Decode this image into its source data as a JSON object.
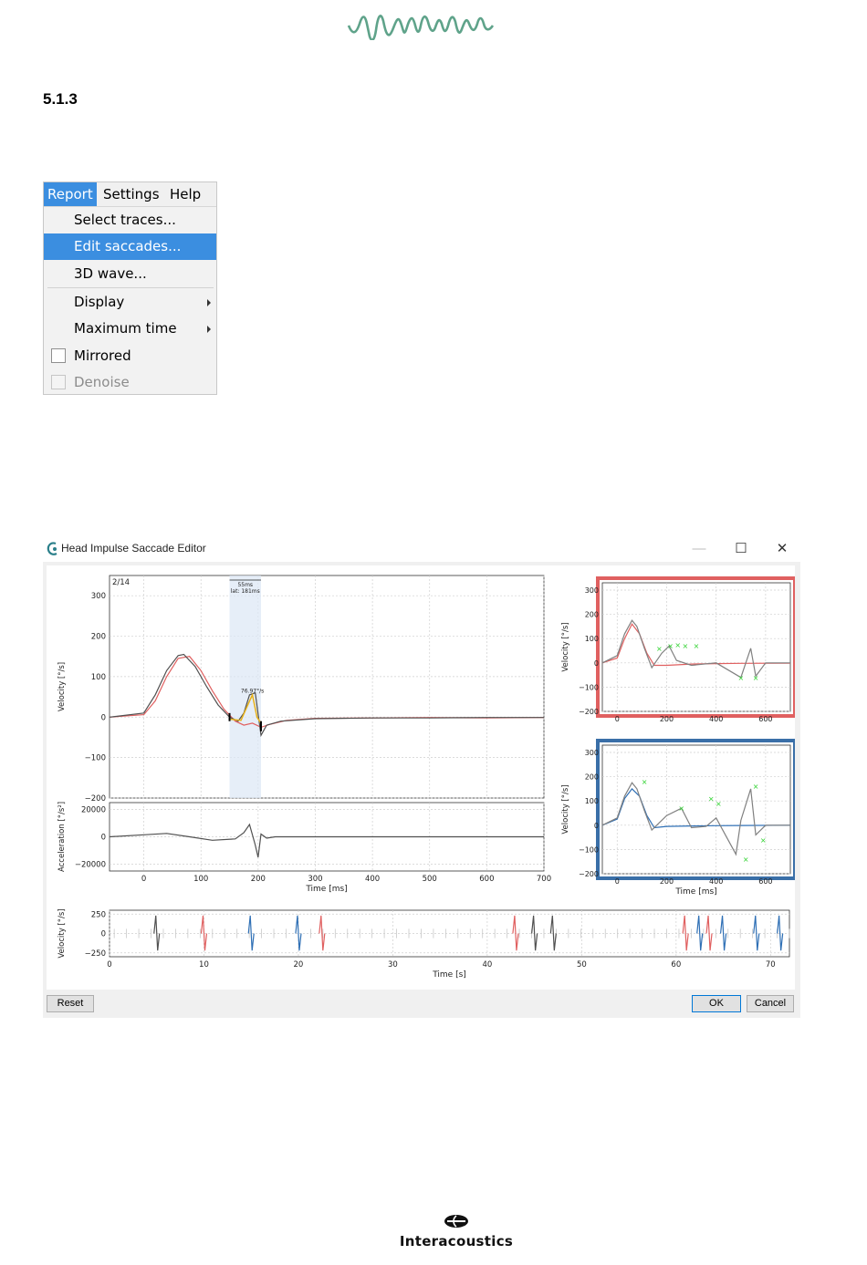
{
  "section_number": "5.1.3",
  "menu": {
    "bar": [
      "Report",
      "Settings",
      "Help"
    ],
    "items": [
      {
        "label": "Select traces...",
        "highlighted": false
      },
      {
        "label": "Edit saccades...",
        "highlighted": true
      },
      {
        "label": "3D wave..."
      },
      {
        "label": "Display",
        "submenu": true
      },
      {
        "label": "Maximum time",
        "submenu": true
      },
      {
        "label": "Mirrored",
        "checkbox": true,
        "checked": false
      },
      {
        "label": "Denoise",
        "checkbox": true,
        "checked": false,
        "disabled": true
      }
    ],
    "accent_color": "#3b8ee0"
  },
  "dialog": {
    "title": "Head Impulse Saccade Editor",
    "minimize": "—",
    "maximize": "☐",
    "close": "✕",
    "buttons": {
      "reset": "Reset",
      "ok": "OK",
      "cancel": "Cancel"
    }
  },
  "chart_data": [
    {
      "type": "line",
      "name": "main-velocity",
      "title": "2/14",
      "ylabel": "Velocity [°/s]",
      "xlim": [
        -60,
        700
      ],
      "ylim": [
        -200,
        350
      ],
      "yticks": [
        300,
        200,
        100,
        0,
        -100,
        -200
      ],
      "highlight_range": [
        150,
        205
      ],
      "annotations": [
        "55ms",
        "lat: 181ms",
        "76.97°/s"
      ],
      "series": [
        {
          "color": "#e06060",
          "x": [
            -60,
            0,
            20,
            40,
            60,
            80,
            100,
            120,
            140,
            160,
            175,
            190,
            205,
            220,
            250,
            300,
            400,
            500,
            600,
            700
          ],
          "y": [
            0,
            6,
            40,
            100,
            145,
            150,
            115,
            65,
            20,
            -10,
            -20,
            -15,
            -25,
            -18,
            -8,
            -3,
            -2,
            -1,
            -2,
            -1
          ]
        },
        {
          "color": "#505050",
          "x": [
            -60,
            0,
            20,
            40,
            60,
            70,
            90,
            110,
            130,
            150,
            165,
            175,
            185,
            195,
            205,
            215,
            240,
            300,
            400,
            500,
            600,
            700
          ],
          "y": [
            0,
            10,
            55,
            115,
            152,
            155,
            125,
            75,
            30,
            0,
            -10,
            10,
            55,
            60,
            -45,
            -20,
            -10,
            -4,
            -2,
            -2,
            -1,
            -1
          ]
        }
      ]
    },
    {
      "type": "line",
      "name": "main-acceleration",
      "ylabel": "Acceleration [°/s²]",
      "xlabel": "Time [ms]",
      "xlim": [
        -60,
        700
      ],
      "ylim": [
        -25000,
        25000
      ],
      "yticks": [
        20000,
        0,
        -20000
      ],
      "xticks": [
        0,
        100,
        200,
        300,
        400,
        500,
        600,
        700
      ],
      "series": [
        {
          "color": "#505050",
          "x": [
            -60,
            0,
            40,
            80,
            120,
            160,
            175,
            185,
            195,
            200,
            205,
            215,
            230,
            300,
            700
          ],
          "y": [
            0,
            1500,
            2500,
            0,
            -2500,
            -1500,
            3000,
            9000,
            -6000,
            -15000,
            2000,
            -1000,
            0,
            0,
            0
          ]
        }
      ]
    },
    {
      "type": "line",
      "name": "lateral-right",
      "ylabel": "Velocity [°/s]",
      "ylim": [
        -200,
        330
      ],
      "yticks": [
        300,
        200,
        100,
        0,
        -100,
        -200
      ],
      "xlim": [
        -60,
        700
      ],
      "xticks": [
        0,
        200,
        400,
        600
      ],
      "frame_color": "#e06060",
      "series": [
        {
          "color": "#e06060",
          "x": [
            -60,
            0,
            30,
            60,
            90,
            120,
            150,
            200,
            300,
            400,
            500,
            700
          ],
          "y": [
            0,
            20,
            100,
            160,
            120,
            40,
            -10,
            -10,
            -5,
            -3,
            -2,
            -1
          ]
        },
        {
          "color": "#808080",
          "x": [
            -60,
            0,
            30,
            60,
            80,
            110,
            140,
            180,
            210,
            240,
            300,
            400,
            500,
            540,
            560,
            600,
            700
          ],
          "y": [
            0,
            30,
            120,
            175,
            150,
            60,
            -20,
            40,
            70,
            10,
            -10,
            0,
            -60,
            60,
            -55,
            0,
            0
          ]
        }
      ],
      "markers": [
        [
          170,
          60
        ],
        [
          215,
          70
        ],
        [
          245,
          75
        ],
        [
          275,
          70
        ],
        [
          320,
          70
        ],
        [
          500,
          -60
        ],
        [
          560,
          -60
        ]
      ]
    },
    {
      "type": "line",
      "name": "lateral-left",
      "ylabel": "Velocity [°/s]",
      "xlabel": "Time [ms]",
      "ylim": [
        -200,
        330
      ],
      "yticks": [
        300,
        200,
        100,
        0,
        -100,
        -200
      ],
      "xlim": [
        -60,
        700
      ],
      "xticks": [
        0,
        200,
        400,
        600
      ],
      "frame_color": "#3a6fa8",
      "series": [
        {
          "color": "#2e6fb5",
          "x": [
            -60,
            0,
            30,
            60,
            90,
            120,
            150,
            200,
            300,
            400,
            500,
            700
          ],
          "y": [
            0,
            25,
            110,
            150,
            120,
            40,
            -10,
            -5,
            -3,
            -2,
            -1,
            0
          ]
        },
        {
          "color": "#808080",
          "x": [
            -60,
            0,
            30,
            60,
            80,
            110,
            140,
            200,
            260,
            300,
            360,
            400,
            480,
            500,
            540,
            560,
            600,
            700
          ],
          "y": [
            0,
            30,
            120,
            175,
            150,
            60,
            -20,
            40,
            70,
            -10,
            -5,
            30,
            -120,
            20,
            150,
            -40,
            0,
            0
          ]
        }
      ],
      "markers": [
        [
          110,
          180
        ],
        [
          260,
          70
        ],
        [
          380,
          110
        ],
        [
          410,
          90
        ],
        [
          520,
          -140
        ],
        [
          560,
          160
        ],
        [
          590,
          -60
        ]
      ]
    },
    {
      "type": "line",
      "name": "overview",
      "ylabel": "Velocity [°/s]",
      "xlabel": "Time [s]",
      "xlim": [
        0,
        72
      ],
      "ylim": [
        -300,
        300
      ],
      "yticks": [
        250,
        0,
        -250
      ],
      "xticks": [
        0,
        10,
        20,
        30,
        40,
        50,
        60,
        70
      ],
      "impulses": [
        {
          "t": 5,
          "color": "#505050"
        },
        {
          "t": 10,
          "color": "#e06060"
        },
        {
          "t": 15,
          "color": "#2e6fb5"
        },
        {
          "t": 20,
          "color": "#2e6fb5"
        },
        {
          "t": 22.5,
          "color": "#e06060"
        },
        {
          "t": 43,
          "color": "#e06060"
        },
        {
          "t": 45,
          "color": "#505050"
        },
        {
          "t": 47,
          "color": "#505050"
        },
        {
          "t": 61,
          "color": "#e06060"
        },
        {
          "t": 62.5,
          "color": "#2e6fb5"
        },
        {
          "t": 63.5,
          "color": "#e06060"
        },
        {
          "t": 65,
          "color": "#2e6fb5"
        },
        {
          "t": 68.5,
          "color": "#2e6fb5"
        },
        {
          "t": 71,
          "color": "#2e6fb5"
        }
      ]
    }
  ],
  "footer": {
    "brand": "Interacoustics"
  },
  "colors": {
    "logo_green": "#5fa38a"
  }
}
